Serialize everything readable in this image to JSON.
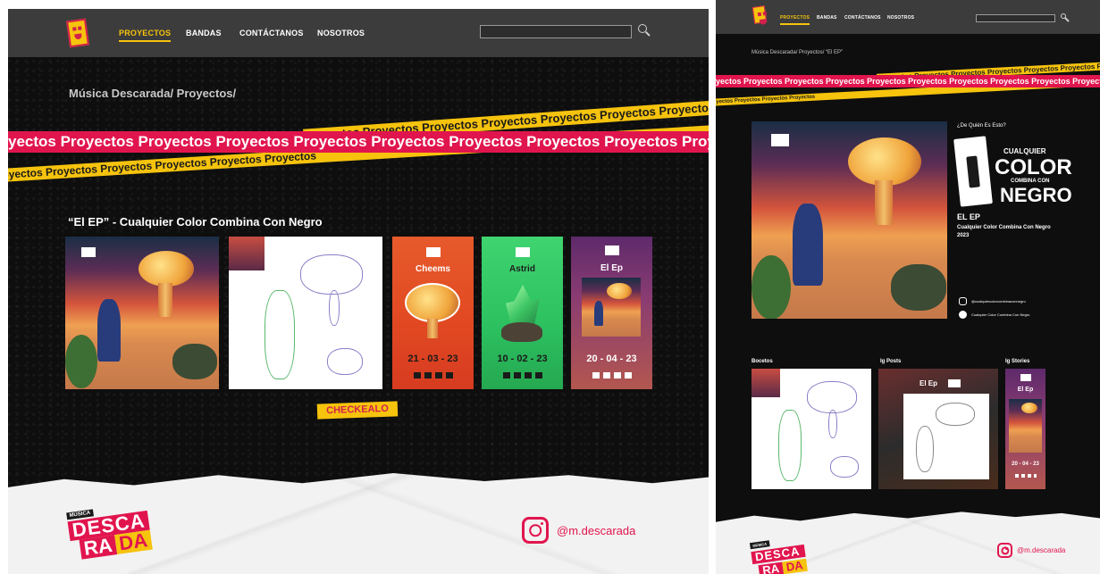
{
  "left": {
    "nav": {
      "items": [
        {
          "label": "PROYECTOS",
          "active": true
        },
        {
          "label": "BANDAS",
          "active": false
        },
        {
          "label": "CONTÁCTANOS",
          "active": false
        },
        {
          "label": "NOSOTROS",
          "active": false
        }
      ],
      "search_placeholder": ""
    },
    "breadcrumb": "Música Descarada/ Proyectos/",
    "ribbon_red": "yectos Proyectos Proyectos Proyectos Proyectos Proyectos Proyectos Proyectos Proyectos Proyectos Proye",
    "ribbon_yellow_top": "Proyectos Proyectos Proyectos Proyectos Proyectos Proyectos Proyectos Proyectos Pro",
    "ribbon_yellow_bottom": "Proyectos Proyectos Proyectos Proyectos Proyectos Proyectos",
    "project_title": "“El EP” - Cualquier Color Combina Con Negro",
    "stories": [
      {
        "title": "Cheems",
        "date": "21 - 03 - 23"
      },
      {
        "title": "Astrid",
        "date": "10 - 02 - 23"
      },
      {
        "title": "El Ep",
        "date": "20 - 04 - 23"
      }
    ],
    "cta_label": "CHECKEALO",
    "footer": {
      "logo_small": "MÚSICA",
      "logo_line1": "DESCA",
      "logo_line2_a": "RA",
      "logo_line2_b": "DA",
      "instagram_handle": "@m.descarada"
    }
  },
  "right": {
    "nav": {
      "items": [
        {
          "label": "PROYECTOS",
          "active": true
        },
        {
          "label": "BANDAS",
          "active": false
        },
        {
          "label": "CONTÁCTANOS",
          "active": false
        },
        {
          "label": "NOSOTROS",
          "active": false
        }
      ]
    },
    "breadcrumb": "Música Descarada/ Proyectos/ “El EP”",
    "ribbon_red": "yectos Proyectos Proyectos Proyectos Proyectos Proyectos Proyectos Proyectos Proyectos Proyectos",
    "ribbon_yellow": "Proyectos Proyectos Proyectos Proyectos Proyectos Proyectos Pro",
    "ribbon_yellow_bottom": "Proyectos Proyectos Proyectos Proyectos",
    "whose_label": "¿De Quién Es Esto?",
    "band_logo": {
      "line1": "CUALQUIER",
      "line2": "COLOR",
      "line3": "COMBINA CON",
      "line4": "NEGRO"
    },
    "release_title": "EL EP",
    "release_artist": "Cualquier Color Combina Con Negro",
    "release_year": "2023",
    "instagram": "@cualquiercolorcombinaconnegro",
    "spotify": "Cualquier Color Combina Con Negro",
    "sections": {
      "bocetos": "Bocetos",
      "ig_posts": "Ig Posts",
      "ig_stories": "Ig Stories"
    },
    "ig_post_title": "El Ep",
    "ig_story_title": "El Ep",
    "ig_story_date": "20 - 04 - 23",
    "footer": {
      "logo_small": "MÚSICA",
      "logo_line1": "DESCA",
      "logo_line2_a": "RA",
      "logo_line2_b": "DA",
      "instagram_handle": "@m.descarada"
    }
  },
  "colors": {
    "accent_yellow": "#f6c30d",
    "accent_red": "#e1154e",
    "background": "#0e0e0e",
    "navbar": "#3c3c3c"
  }
}
